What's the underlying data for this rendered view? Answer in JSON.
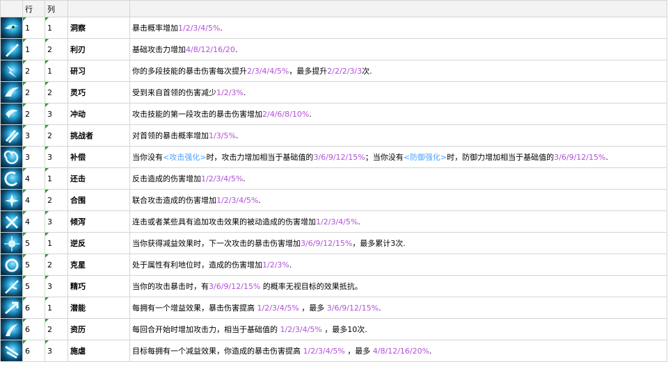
{
  "headers": {
    "row": "行",
    "col": "列"
  },
  "rows": [
    {
      "row": "1",
      "col": "1",
      "name": "洞察",
      "desc": [
        {
          "t": "暴击概率增加"
        },
        {
          "t": "1/2/3/4/5%",
          "c": "hl"
        },
        {
          "t": "."
        }
      ],
      "icon": "eye-icon"
    },
    {
      "row": "1",
      "col": "2",
      "name": "利刃",
      "desc": [
        {
          "t": "基础攻击力增加"
        },
        {
          "t": "4/8/12/16/20",
          "c": "hl"
        },
        {
          "t": "."
        }
      ],
      "icon": "blade-icon"
    },
    {
      "row": "2",
      "col": "1",
      "name": "研习",
      "desc": [
        {
          "t": "你的多段技能的暴击伤害每次提升"
        },
        {
          "t": "2/3/4/4/5%",
          "c": "hl"
        },
        {
          "t": "，最多提升"
        },
        {
          "t": "2/2/2/3/3",
          "c": "hl"
        },
        {
          "t": "次."
        }
      ],
      "icon": "lightning-icon"
    },
    {
      "row": "2",
      "col": "2",
      "name": "灵巧",
      "desc": [
        {
          "t": "受到来自首领的伤害减少"
        },
        {
          "t": "1/2/3%",
          "c": "hl"
        },
        {
          "t": "."
        }
      ],
      "icon": "wing-icon"
    },
    {
      "row": "2",
      "col": "3",
      "name": "冲动",
      "desc": [
        {
          "t": "攻击技能的第一段攻击的暴击伤害增加"
        },
        {
          "t": "2/4/6/8/10%",
          "c": "hl"
        },
        {
          "t": "."
        }
      ],
      "icon": "wave-icon"
    },
    {
      "row": "3",
      "col": "2",
      "name": "挑战者",
      "desc": [
        {
          "t": "对首领的暴击概率增加"
        },
        {
          "t": "1/3/5%",
          "c": "hl"
        },
        {
          "t": "."
        }
      ],
      "icon": "claw-icon"
    },
    {
      "row": "3",
      "col": "3",
      "name": "补偿",
      "desc": [
        {
          "t": "当你没有"
        },
        {
          "t": "<攻击强化>",
          "c": "blue"
        },
        {
          "t": "时，攻击力增加相当于基础值的"
        },
        {
          "t": "3/6/9/12/15%",
          "c": "hl"
        },
        {
          "t": "；当你没有"
        },
        {
          "t": "<防御强化>",
          "c": "blue"
        },
        {
          "t": "时，防御力增加相当于基础值的"
        },
        {
          "t": "3/6/9/12/15%",
          "c": "hl"
        },
        {
          "t": "."
        }
      ],
      "icon": "spiral-icon"
    },
    {
      "row": "4",
      "col": "1",
      "name": "还击",
      "desc": [
        {
          "t": "反击造成的伤害增加"
        },
        {
          "t": "1/2/3/4/5%",
          "c": "hl"
        },
        {
          "t": "."
        }
      ],
      "icon": "hook-icon"
    },
    {
      "row": "4",
      "col": "2",
      "name": "合围",
      "desc": [
        {
          "t": "联合攻击造成的伤害增加"
        },
        {
          "t": "1/2/3/4/5%",
          "c": "hl"
        },
        {
          "t": "."
        }
      ],
      "icon": "star-icon"
    },
    {
      "row": "4",
      "col": "3",
      "name": "倾泻",
      "desc": [
        {
          "t": "连击或者某些具有追加攻击效果的被动造成的伤害增加"
        },
        {
          "t": "1/2/3/4/5%",
          "c": "hl"
        },
        {
          "t": "."
        }
      ],
      "icon": "cross-icon"
    },
    {
      "row": "5",
      "col": "1",
      "name": "逆反",
      "desc": [
        {
          "t": "当你获得减益效果时，下一次攻击的暴击伤害增加"
        },
        {
          "t": "3/6/9/12/15%",
          "c": "hl"
        },
        {
          "t": "，最多累计3次."
        }
      ],
      "icon": "burst-icon"
    },
    {
      "row": "5",
      "col": "2",
      "name": "克星",
      "desc": [
        {
          "t": "处于属性有利地位时，造成的伤害增加"
        },
        {
          "t": "1/2/3%",
          "c": "hl"
        },
        {
          "t": "."
        }
      ],
      "icon": "orb-icon"
    },
    {
      "row": "5",
      "col": "3",
      "name": "精巧",
      "desc": [
        {
          "t": "当你的攻击暴击时，有"
        },
        {
          "t": "3/6/9/12/15%",
          "c": "hl"
        },
        {
          "t": " 的概率无视目标的效果抵抗。"
        }
      ],
      "icon": "spark-icon"
    },
    {
      "row": "6",
      "col": "1",
      "name": "潜能",
      "desc": [
        {
          "t": "每拥有一个增益效果，暴击伤害提高 "
        },
        {
          "t": "1/2/3/4/5%",
          "c": "hl"
        },
        {
          "t": " ，最多 "
        },
        {
          "t": "3/6/9/12/15%",
          "c": "hl"
        },
        {
          "t": "."
        }
      ],
      "icon": "arrow-icon"
    },
    {
      "row": "6",
      "col": "2",
      "name": "资历",
      "desc": [
        {
          "t": "每回合开始时增加攻击力，相当于基础值的 "
        },
        {
          "t": "1/2/3/4/5%",
          "c": "hl"
        },
        {
          "t": " ，最多10次."
        }
      ],
      "icon": "rise-icon"
    },
    {
      "row": "6",
      "col": "3",
      "name": "施虐",
      "desc": [
        {
          "t": "目标每拥有一个减益效果，你造成的暴击伤害提高 "
        },
        {
          "t": "1/2/3/4/5%",
          "c": "hl"
        },
        {
          "t": " ，最多 "
        },
        {
          "t": "4/8/12/16/20%",
          "c": "hl"
        },
        {
          "t": "."
        }
      ],
      "icon": "slash-icon"
    }
  ]
}
